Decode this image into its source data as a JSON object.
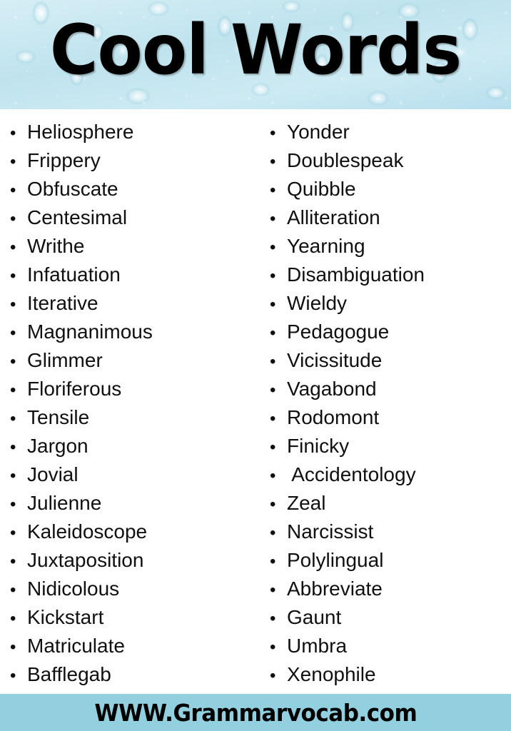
{
  "header": {
    "title": "Cool Words",
    "background_color": "#c8e7f0",
    "texture": "water-droplets"
  },
  "list": {
    "bullet_glyph": "•",
    "columns": [
      {
        "name": "left-column",
        "items": [
          "Heliosphere",
          "Frippery",
          "Obfuscate",
          "Centesimal",
          "Writhe",
          "Infatuation",
          "Iterative",
          "Magnanimous",
          "Glimmer",
          "Floriferous",
          "Tensile",
          "Jargon",
          "Jovial",
          "Julienne",
          "Kaleidoscope",
          "Juxtaposition",
          "Nidicolous",
          "Kickstart",
          "Matriculate",
          "Bafflegab"
        ]
      },
      {
        "name": "right-column",
        "items": [
          "Yonder",
          "Doublespeak",
          "Quibble",
          "Alliteration",
          "Yearning",
          "Disambiguation",
          "Wieldy",
          "Pedagogue",
          "Vicissitude",
          "Vagabond",
          "Rodomont",
          "Finicky",
          " Accidentology",
          "Zeal",
          "Narcissist",
          "Polylingual",
          "Abbreviate",
          "Gaunt",
          "Umbra",
          "Xenophile"
        ]
      }
    ]
  },
  "footer": {
    "website": "WWW.Grammarvocab.com",
    "background_color": "#92d0e0"
  }
}
